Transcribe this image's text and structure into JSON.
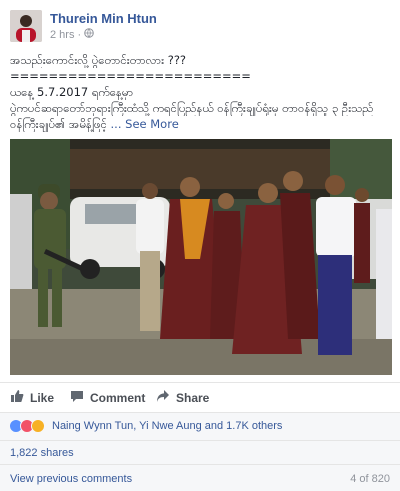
{
  "post": {
    "author": "Thurein Min Htun",
    "time": "2 hrs",
    "text_lines": [
      "အသည်းကောင်းလို့ ပွဲတောင်းတာလား ???",
      "=========================",
      "ယနေ့ 5.7.2017 ရက်နေ့မှာ",
      "ပွဲကပင်ဆရာတော်ဘုရားကြီးထံသို့ ကရင်ပြည်နယ် ဝန်ကြီးချုပ်ရုံးမှ တာဝန်ရှိသူ ၃ ဦးသည်"
    ],
    "last_line": "ဝန်ကြီးချုပ်၏ အမိန့်ဖြင့်",
    "see_more": "... See More"
  },
  "actions": {
    "like": "Like",
    "comment": "Comment",
    "share": "Share"
  },
  "reactions": {
    "names": "Naing Wynn Tun, Yi Nwe Aung and 1.7K others"
  },
  "shares": "1,822 shares",
  "comments": {
    "view_previous": "View previous comments",
    "count": "4 of 820"
  },
  "colors": {
    "link": "#365899",
    "like": "#5890ff",
    "love": "#f25268",
    "haha": "#f7b125"
  }
}
